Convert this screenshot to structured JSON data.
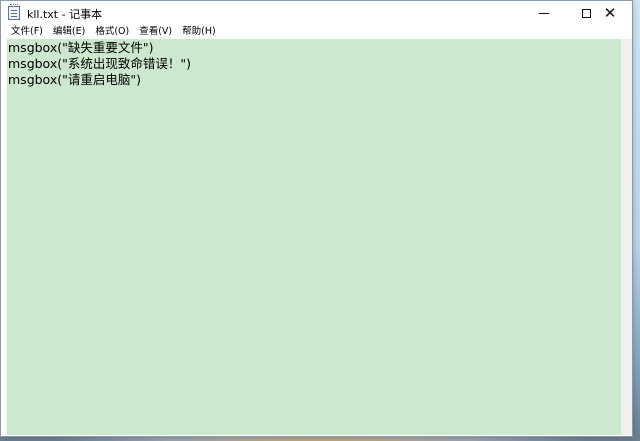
{
  "window": {
    "title": "kll.txt - 记事本",
    "icon": "notepad-icon",
    "controls": {
      "minimize": "minimize-icon",
      "maximize": "maximize-icon",
      "close": "close-icon"
    }
  },
  "menu": {
    "items": [
      {
        "label": "文件(F)"
      },
      {
        "label": "编辑(E)"
      },
      {
        "label": "格式(O)"
      },
      {
        "label": "查看(V)"
      },
      {
        "label": "帮助(H)"
      }
    ]
  },
  "editor": {
    "background": "#cce8cf",
    "lines": [
      "msgbox(\"缺失重要文件\")",
      "msgbox(\"系统出现致命错误！\")",
      "msgbox(\"请重启电脑\")"
    ]
  }
}
